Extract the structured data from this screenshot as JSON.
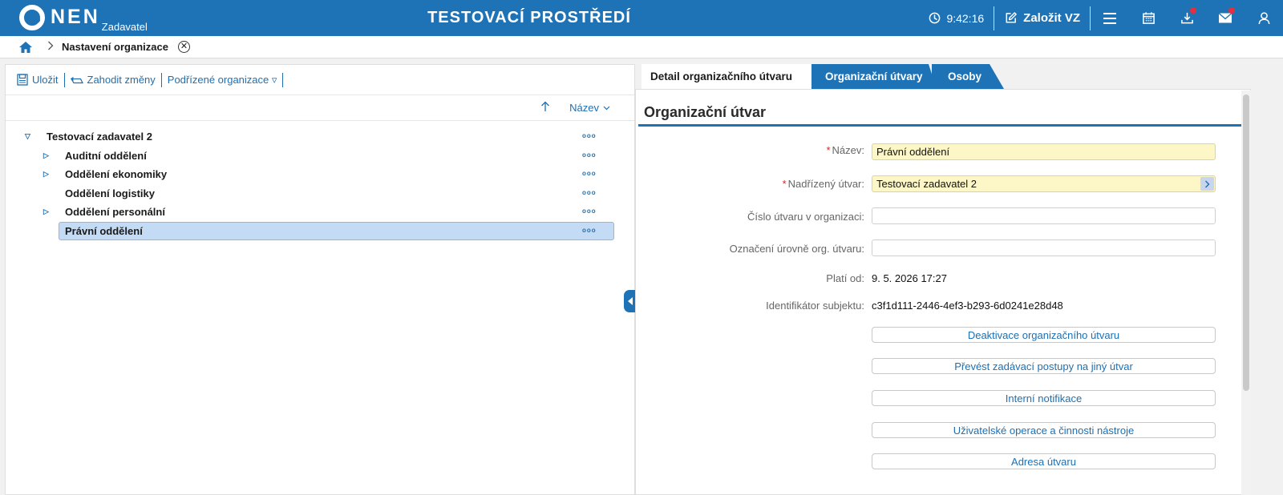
{
  "header": {
    "logo_text": "NEN",
    "logo_sub": "Zadavatel",
    "env_title": "TESTOVACÍ PROSTŘEDÍ",
    "time": "9:42:16",
    "create_label": "Založit VZ"
  },
  "breadcrumb": {
    "current": "Nastavení organizace"
  },
  "toolbar": {
    "save": "Uložit",
    "discard": "Zahodit změny",
    "sub_orgs": "Podřízené organizace ▿"
  },
  "sort": {
    "label": "Název"
  },
  "tree": {
    "root": "Testovací zadavatel 2",
    "items": [
      {
        "label": "Auditní oddělení",
        "expandable": true
      },
      {
        "label": "Oddělení ekonomiky",
        "expandable": true
      },
      {
        "label": "Oddělení logistiky",
        "expandable": false
      },
      {
        "label": "Oddělení personální",
        "expandable": true
      },
      {
        "label": "Právní oddělení",
        "expandable": false,
        "selected": true
      }
    ],
    "more_glyph": "ooo"
  },
  "tabs": {
    "detail": "Detail organizačního útvaru",
    "units": "Organizační útvary",
    "persons": "Osoby"
  },
  "form": {
    "section_title": "Organizační útvar",
    "name_label": "Název:",
    "name_value": "Právní oddělení",
    "parent_label": "Nadřízený útvar:",
    "parent_value": "Testovací zadavatel 2",
    "number_label": "Číslo útvaru v organizaci:",
    "number_value": "",
    "level_label": "Označení úrovně org. útvaru:",
    "level_value": "",
    "valid_label": "Platí od:",
    "valid_value": "9. 5. 2026 17:27",
    "id_label": "Identifikátor subjektu:",
    "id_value": "c3f1d111-2446-4ef3-b293-6d0241e28d48"
  },
  "actions": {
    "deactivate": "Deaktivace organizačního útvaru",
    "transfer": "Převést zadávací postupy na jiný útvar",
    "notifications": "Interní notifikace",
    "user_ops": "Uživatelské operace a činnosti nástroje",
    "address": "Adresa útvaru"
  },
  "colors": {
    "brand": "#1e72b6",
    "link": "#1e6fb1",
    "selected_row": "#c4dbf5",
    "required_field": "#fdf6c6",
    "badge": "#e23040"
  }
}
